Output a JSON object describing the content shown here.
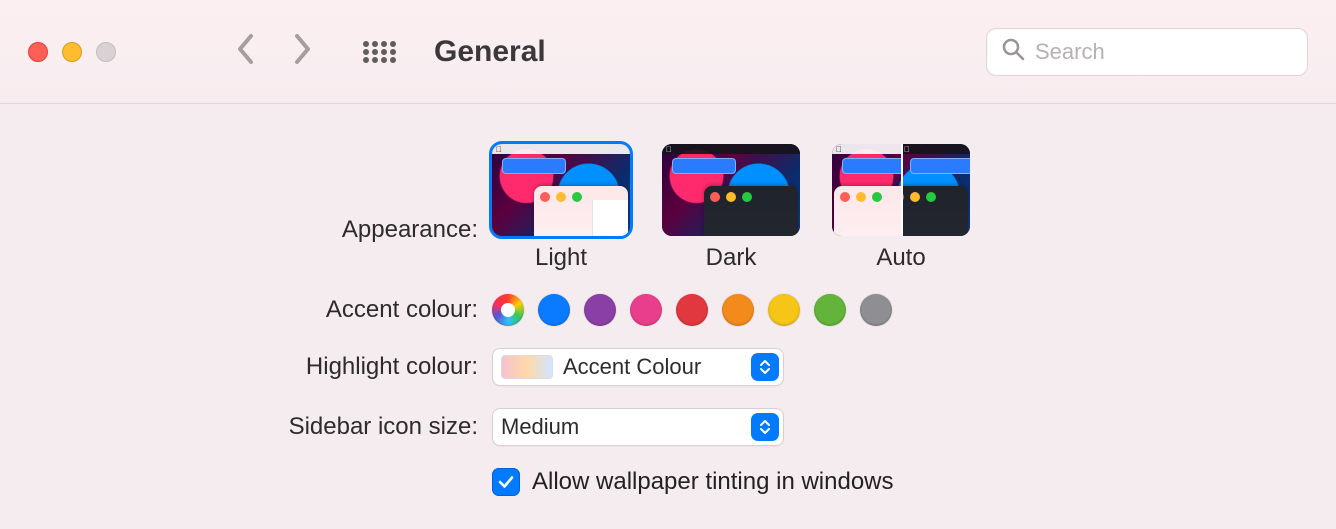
{
  "header": {
    "title": "General",
    "search_placeholder": "Search"
  },
  "labels": {
    "appearance": "Appearance:",
    "accent": "Accent colour:",
    "highlight": "Highlight colour:",
    "sidebar": "Sidebar icon size:"
  },
  "appearance": {
    "selected": "Light",
    "options": [
      "Light",
      "Dark",
      "Auto"
    ]
  },
  "accent_colours": [
    {
      "name": "Multicolour",
      "value": "multicolour"
    },
    {
      "name": "Blue",
      "value": "#0a7aff"
    },
    {
      "name": "Purple",
      "value": "#8a3fa6"
    },
    {
      "name": "Pink",
      "value": "#e83e8c"
    },
    {
      "name": "Red",
      "value": "#e0383e"
    },
    {
      "name": "Orange",
      "value": "#f28a1c"
    },
    {
      "name": "Yellow",
      "value": "#f5c518"
    },
    {
      "name": "Green",
      "value": "#62b43a"
    },
    {
      "name": "Graphite",
      "value": "#8e8e93"
    }
  ],
  "highlight": {
    "selected": "Accent Colour"
  },
  "sidebar_icon_size": {
    "selected": "Medium"
  },
  "wallpaper_tinting": {
    "checked": true,
    "label": "Allow wallpaper tinting in windows"
  }
}
